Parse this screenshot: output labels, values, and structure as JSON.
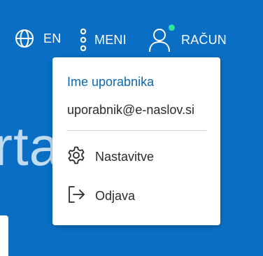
{
  "header": {
    "language_label": "EN",
    "menu_label": "MENI",
    "account_label": "RAČUN"
  },
  "hero": {
    "partial_text": "rta"
  },
  "account_menu": {
    "username": "Ime uporabnika",
    "email": "uporabnik@e-naslov.si",
    "settings_label": "Nastavitve",
    "logout_label": "Odjava"
  },
  "colors": {
    "background": "#0a6fc4",
    "accent": "#0b67b5",
    "status_online": "#2ee59d"
  },
  "icons": {
    "language": "globe-icon",
    "menu": "vertical-dots-icon",
    "account": "user-icon",
    "settings": "gear-icon",
    "logout": "logout-icon"
  }
}
